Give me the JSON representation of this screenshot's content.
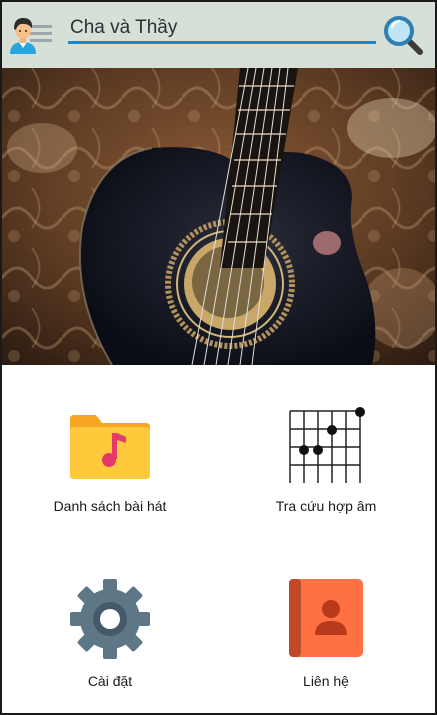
{
  "search": {
    "value": "Cha và Thầy",
    "placeholder": ""
  },
  "header": {
    "menu_icon": "user-menu-icon",
    "search_icon": "magnifier-icon",
    "background_color": "#d7e0d7",
    "accent_color": "#1e88c8"
  },
  "hero": {
    "image": "acoustic-guitar-photo"
  },
  "menu": {
    "items": [
      {
        "label": "Danh sách bài hát",
        "icon": "music-folder-icon"
      },
      {
        "label": "Tra cứu hợp âm",
        "icon": "chord-diagram-icon"
      },
      {
        "label": "Cài đặt",
        "icon": "gear-icon"
      },
      {
        "label": "Liên hệ",
        "icon": "contact-book-icon"
      }
    ]
  }
}
